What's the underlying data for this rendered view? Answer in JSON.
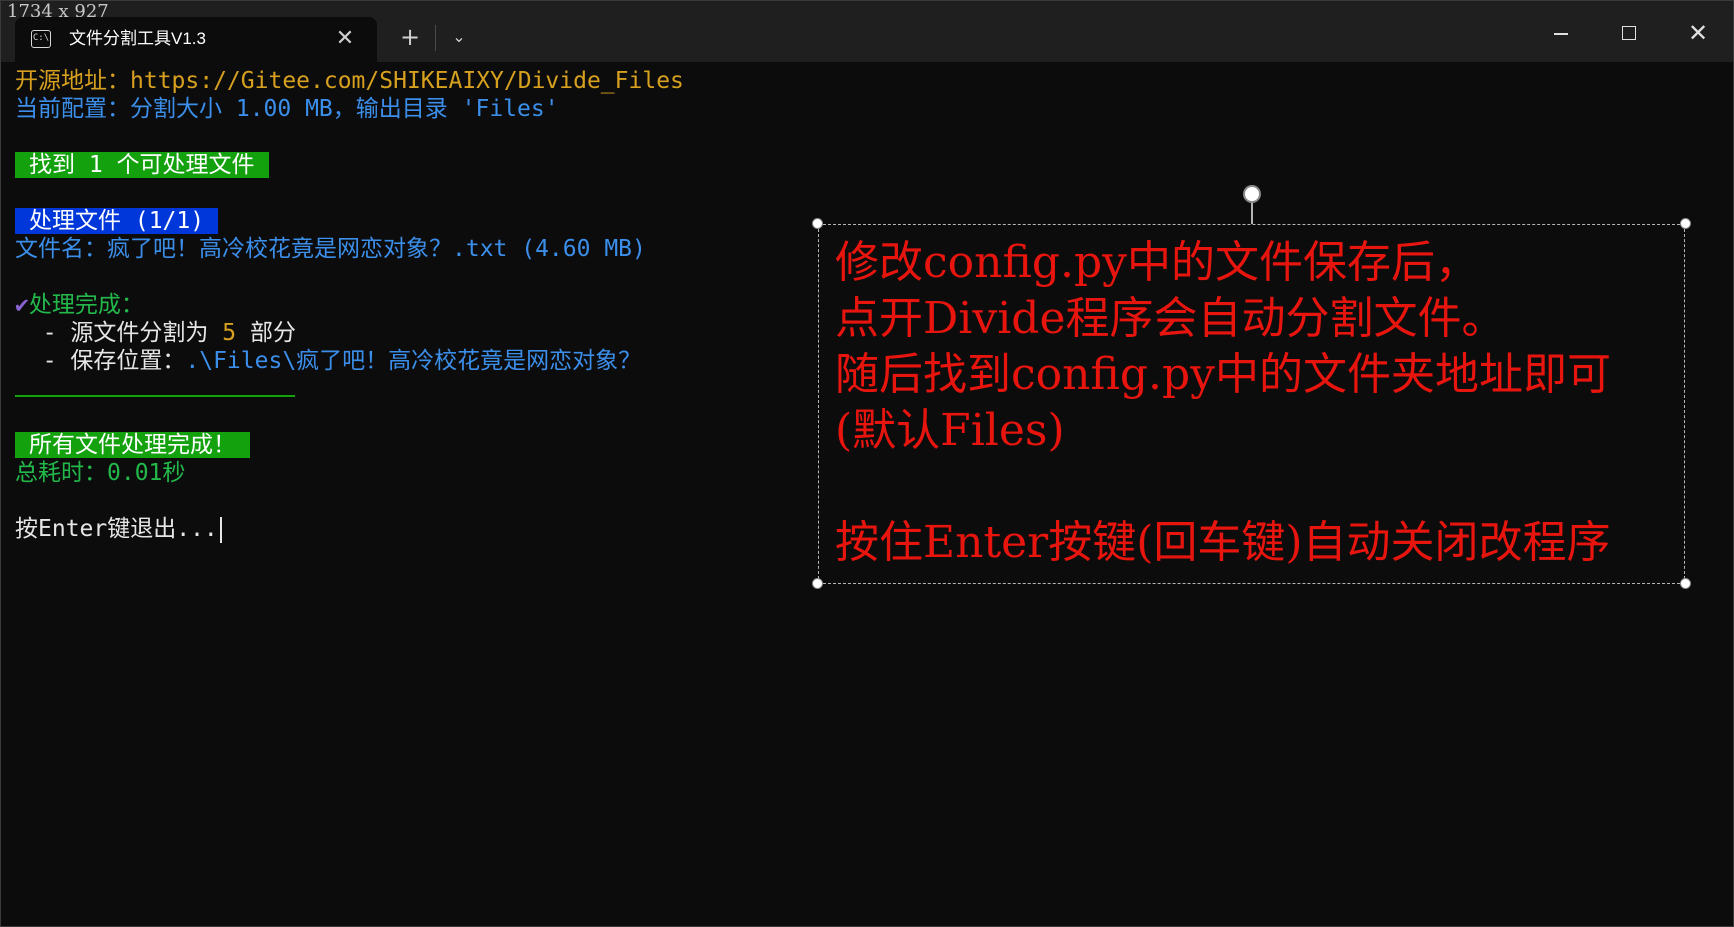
{
  "screenshot_label": "1734 x 927",
  "window": {
    "tab_icon_text": "C:\\",
    "tab_title": "文件分割工具V1.3",
    "tab_close_glyph": "✕",
    "new_tab_glyph": "+",
    "dropdown_glyph": "⌄",
    "close_glyph": "✕"
  },
  "terminal": {
    "line1_label": "开源地址：",
    "line1_url": "https://Gitee.com/SHIKEAIXY/Divide_Files",
    "line2": "当前配置：分割大小 1.00 MB，输出目录 'Files'",
    "found_badge": "找到 1 个可处理文件",
    "processing_badge": "处理文件 (1/1)",
    "filename_line": "文件名：疯了吧！高冷校花竟是网恋对象？.txt (4.60 MB)",
    "check_glyph": "✔",
    "done_label": "处理完成：",
    "split_prefix": "  - 源文件分割为 ",
    "split_count": "5",
    "split_suffix": " 部分",
    "save_prefix": "  - 保存位置：",
    "save_path": ".\\Files\\疯了吧！高冷校花竟是网恋对象？",
    "all_done_badge": "所有文件处理完成！",
    "total_time": "总耗时：0.01秒",
    "exit_prompt": "按Enter键退出..."
  },
  "annotation": {
    "lines": [
      "修改config.py中的文件保存后，",
      "点开Divide程序会自动分割文件。",
      "随后找到config.py中的文件夹地址即可",
      "(默认Files)",
      "",
      "按住Enter按键(回车键)自动关闭改程序"
    ],
    "color": "#e8150f"
  },
  "colors": {
    "background": "#0c0c0c",
    "yellow": "#d7a01f",
    "blue": "#3b8eea",
    "green": "#23b84a",
    "badge_green": "#13a10e",
    "badge_blue": "#0037da"
  }
}
